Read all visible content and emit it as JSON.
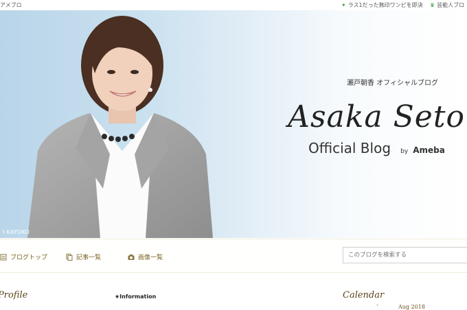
{
  "topbar": {
    "left_label": "アメブロ",
    "link1": "ラス1だった無印ワンピを即決",
    "link2": "芸能人ブロ"
  },
  "header": {
    "photo_caption": "I KAYOKO",
    "jp_title": "瀬戸朝香 オフィシャルブログ",
    "script_title": "Asaka Seto",
    "official_blog": "Official Blog",
    "by": "by",
    "brand": "Ameba"
  },
  "nav": {
    "items": [
      {
        "label": "ブログトップ",
        "icon": "blog-top-icon"
      },
      {
        "label": "記事一覧",
        "icon": "articles-icon"
      },
      {
        "label": "画像一覧",
        "icon": "camera-icon"
      }
    ],
    "search_placeholder": "このブログを検索する"
  },
  "sections": {
    "profile": "Profile",
    "information": "★Information",
    "calendar": "Calendar",
    "calendar_month": "Aug 2018"
  },
  "colors": {
    "accent": "#7a6425",
    "sky": "#b9d5e9"
  }
}
